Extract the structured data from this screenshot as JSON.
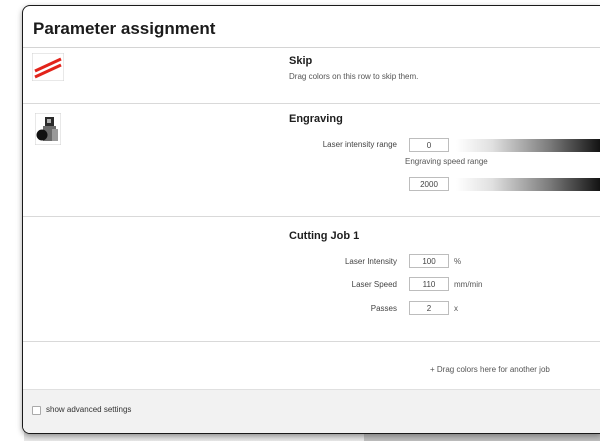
{
  "dialog": {
    "title": "Parameter assignment"
  },
  "skip_row": {
    "icon": "red-stripes-icon",
    "heading": "Skip",
    "hint": "Drag colors on this row to skip them."
  },
  "engraving": {
    "icon": "engraving-photo-icon",
    "heading": "Engraving",
    "intensity_label": "Laser intensity range",
    "intensity_value": "0",
    "speed_label": "Engraving speed range",
    "speed_value": "2000"
  },
  "cutting_job": {
    "heading": "Cutting Job 1",
    "intensity_label": "Laser Intensity",
    "intensity_value": "100",
    "intensity_unit": "%",
    "speed_label": "Laser Speed",
    "speed_value": "110",
    "speed_unit": "mm/min",
    "passes_label": "Passes",
    "passes_value": "2",
    "passes_unit": "x"
  },
  "drop_hint": "+ Drag colors here for another job",
  "footer": {
    "advanced_label": "show advanced settings",
    "advanced_checked": false
  },
  "colors": {
    "skip_red": "#e2231a",
    "dialog_border": "#1a1a1a",
    "footer_bg": "#f2f2f2"
  }
}
